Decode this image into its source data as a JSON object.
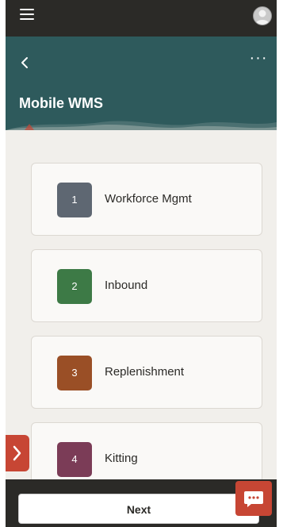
{
  "topbar": {
    "menu_icon": "hamburger-icon",
    "avatar_icon": "user-avatar-icon"
  },
  "header": {
    "title": "Mobile WMS",
    "back_icon": "chevron-left-icon",
    "more_label": "···"
  },
  "menu": [
    {
      "number": "1",
      "label": "Workforce Mgmt",
      "color": "#5e6772"
    },
    {
      "number": "2",
      "label": "Inbound",
      "color": "#3d7a46"
    },
    {
      "number": "3",
      "label": "Replenishment",
      "color": "#9a4f26"
    },
    {
      "number": "4",
      "label": "Kitting",
      "color": "#7b3c57"
    }
  ],
  "footer": {
    "next_label": "Next"
  },
  "colors": {
    "accent": "#c74634",
    "header": "#2e5a5c",
    "dark": "#2b2a27"
  }
}
